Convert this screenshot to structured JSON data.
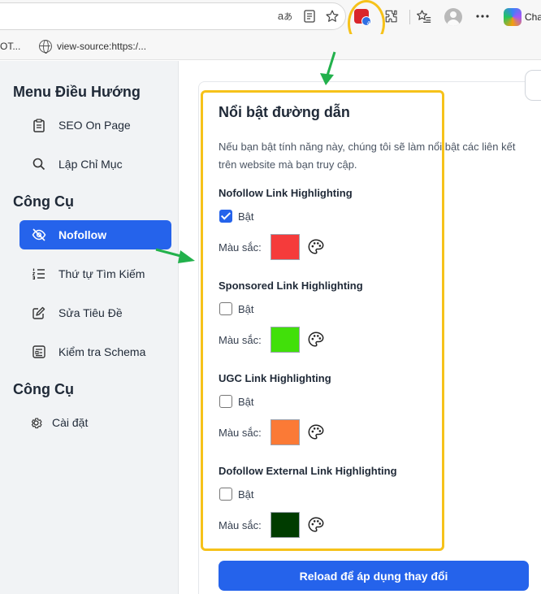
{
  "browser": {
    "address_text": "",
    "copilot_label": "Cha",
    "ext_badge_count": "4",
    "bookmarks": [
      {
        "label": "OT..."
      },
      {
        "label": "view-source:https:/..."
      }
    ]
  },
  "sidebar": {
    "menu_title": "Menu Điều Hướng",
    "menu_items": [
      {
        "label": "SEO On Page",
        "icon": "clipboard-icon"
      },
      {
        "label": "Lập Chỉ Mục",
        "icon": "search-icon"
      }
    ],
    "tools_title": "Công Cụ",
    "tools_items": [
      {
        "label": "Nofollow",
        "icon": "eye-off-icon",
        "active": true
      },
      {
        "label": "Thứ tự Tìm Kiếm",
        "icon": "list-ordered-icon"
      },
      {
        "label": "Sửa Tiêu Đề",
        "icon": "edit-icon"
      },
      {
        "label": "Kiểm tra Schema",
        "icon": "schema-icon"
      }
    ],
    "tools2_title": "Công Cụ",
    "settings_label": "Cài đặt"
  },
  "panel": {
    "title": "Nổi bật đường dẫn",
    "description": "Nếu bạn bật tính năng này, chúng tôi sẽ làm nổi bật các liên kết trên website mà bạn truy cập.",
    "sections": [
      {
        "heading": "Nofollow Link Highlighting",
        "toggle_label": "Bật",
        "checked": true,
        "color_label": "Màu sắc:",
        "color": "#f53b3b"
      },
      {
        "heading": "Sponsored Link Highlighting",
        "toggle_label": "Bật",
        "checked": false,
        "color_label": "Màu sắc:",
        "color": "#41e00a"
      },
      {
        "heading": "UGC Link Highlighting",
        "toggle_label": "Bật",
        "checked": false,
        "color_label": "Màu sắc:",
        "color": "#fb7a36"
      },
      {
        "heading": "Dofollow External Link Highlighting",
        "toggle_label": "Bật",
        "checked": false,
        "color_label": "Màu sắc:",
        "color": "#003c00"
      }
    ],
    "reload_label": "Reload để áp dụng thay đổi"
  },
  "colors": {
    "accent": "#2563eb",
    "highlight": "#f6c21a",
    "annotation_arrow": "#22b14c"
  }
}
